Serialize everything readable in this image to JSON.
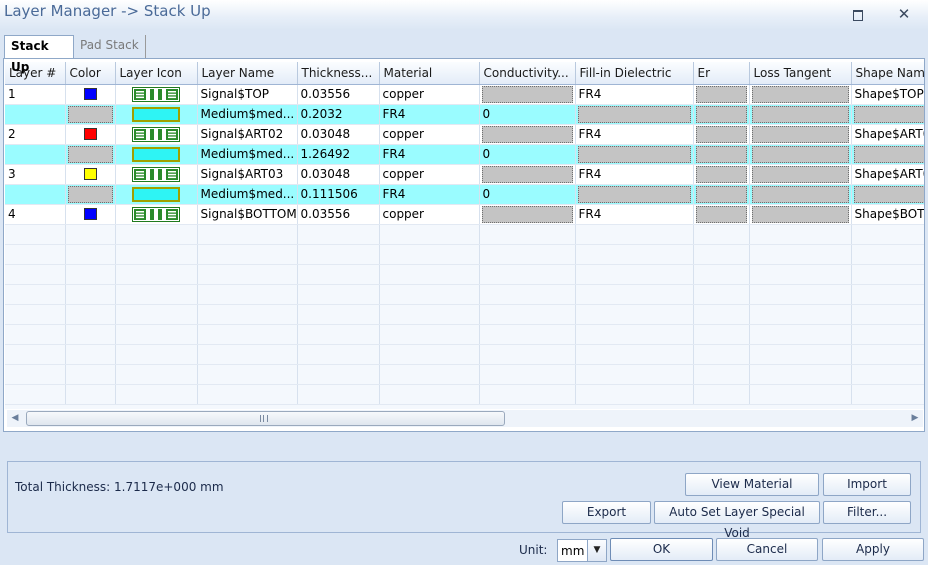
{
  "window": {
    "title": "Layer Manager -> Stack Up"
  },
  "tabs": [
    {
      "label": "Stack Up",
      "active": true
    },
    {
      "label": "Pad Stack",
      "active": false
    }
  ],
  "grid": {
    "columns": [
      "Layer #",
      "Color",
      "Layer Icon",
      "Layer Name",
      "Thickness...",
      "Material",
      "Conductivity...",
      "Fill-in Dielectric",
      "Er",
      "Loss Tangent",
      "Shape Nam"
    ],
    "rows": [
      {
        "type": "copper",
        "layer": "1",
        "color": "#0000ff",
        "name": "Signal$TOP",
        "thickness": "0.03556",
        "material": "copper",
        "conductivity": "",
        "fill": "FR4",
        "er": "",
        "loss": "",
        "shape": "Shape$TOP"
      },
      {
        "type": "dielectric",
        "layer": "",
        "color": "",
        "name": "Medium$med...",
        "thickness": "0.2032",
        "material": "FR4",
        "conductivity": "0",
        "fill": "",
        "er": "",
        "loss": "",
        "shape": ""
      },
      {
        "type": "copper",
        "layer": "2",
        "color": "#ff0000",
        "name": "Signal$ART02",
        "thickness": "0.03048",
        "material": "copper",
        "conductivity": "",
        "fill": "FR4",
        "er": "",
        "loss": "",
        "shape": "Shape$ART0"
      },
      {
        "type": "dielectric",
        "layer": "",
        "color": "",
        "name": "Medium$med...",
        "thickness": "1.26492",
        "material": "FR4",
        "conductivity": "0",
        "fill": "",
        "er": "",
        "loss": "",
        "shape": ""
      },
      {
        "type": "copper",
        "layer": "3",
        "color": "#ffff00",
        "name": "Signal$ART03",
        "thickness": "0.03048",
        "material": "copper",
        "conductivity": "",
        "fill": "FR4",
        "er": "",
        "loss": "",
        "shape": "Shape$ART0"
      },
      {
        "type": "dielectric",
        "layer": "",
        "color": "",
        "name": "Medium$med...",
        "thickness": "0.111506",
        "material": "FR4",
        "conductivity": "0",
        "fill": "",
        "er": "",
        "loss": "",
        "shape": ""
      },
      {
        "type": "copper",
        "layer": "4",
        "color": "#0000ff",
        "name": "Signal$BOTTOM",
        "thickness": "0.03556",
        "material": "copper",
        "conductivity": "",
        "fill": "FR4",
        "er": "",
        "loss": "",
        "shape": "Shape$BOTT"
      }
    ]
  },
  "summary": {
    "total_thickness": "Total Thickness: 1.7117e+000 mm"
  },
  "buttons": {
    "view_material": "View Material",
    "import": "Import",
    "export": "Export",
    "auto_set": "Auto Set Layer Special Void",
    "filter": "Filter...",
    "ok": "OK",
    "cancel": "Cancel",
    "apply": "Apply"
  },
  "unit": {
    "label": "Unit:",
    "value": "mm"
  },
  "icons": {
    "maximize": "maximize-icon",
    "close": "close-icon",
    "dropdown": "chevron-down-icon",
    "scroll_left": "arrow-left-icon",
    "scroll_right": "arrow-right-icon"
  }
}
